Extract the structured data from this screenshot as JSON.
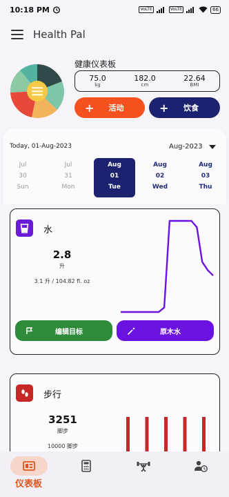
{
  "status_bar": {
    "time": "10:18 PM",
    "network_1": "VoLTE",
    "network_2": "VoLTE",
    "battery": "66"
  },
  "app_bar": {
    "title": "Health Pal",
    "menu_icon": "hamburger-icon"
  },
  "summary": {
    "title": "健康仪表板",
    "stats": [
      {
        "value": "75.0",
        "unit": "kg"
      },
      {
        "value": "182.0",
        "unit": "cm"
      },
      {
        "value": "22.64",
        "unit": "BMI"
      }
    ],
    "activity_button": {
      "icon": "+",
      "label": "活动",
      "color": "#f4511e"
    },
    "diet_button": {
      "icon": "+",
      "label": "饮食",
      "color": "#1c2270"
    }
  },
  "date_strip": {
    "today_label": "Today, 01-Aug-2023",
    "month_selector": "Aug-2023",
    "days": [
      {
        "month": "Jul",
        "date": "30",
        "weekday": "Sun",
        "state": "past"
      },
      {
        "month": "Jul",
        "date": "31",
        "weekday": "Mon",
        "state": "past"
      },
      {
        "month": "Aug",
        "date": "01",
        "weekday": "Tue",
        "state": "selected"
      },
      {
        "month": "Aug",
        "date": "02",
        "weekday": "Wed",
        "state": "future"
      },
      {
        "month": "Aug",
        "date": "03",
        "weekday": "Thu",
        "state": "future"
      }
    ]
  },
  "water_card": {
    "title": "水",
    "value": "2.8",
    "unit": "升",
    "detail": "3.1 升 / 104.82 fl. oz",
    "edit_goal_label": "编辑目标",
    "raw_water_label": "原木水",
    "line_color": "#6a12e0",
    "trend_levels": [
      0.0,
      0.0,
      0.0,
      0.0,
      0.0,
      0.0,
      0.0,
      0.0,
      0.05,
      1.0,
      1.0,
      1.0,
      1.0,
      1.0,
      0.93,
      0.55,
      0.46,
      0.4
    ]
  },
  "walk_card": {
    "title": "步行",
    "value": "3251",
    "unit": "脚步",
    "goal": "10000 脚步",
    "bar_color": "#c62828",
    "bar_count": 5
  },
  "bottom_nav": {
    "items": [
      {
        "name": "dashboard",
        "label": "仪表板",
        "active": true
      },
      {
        "name": "calculator",
        "label": "",
        "active": false
      },
      {
        "name": "fitness",
        "label": "",
        "active": false
      },
      {
        "name": "profile-history",
        "label": "",
        "active": false
      }
    ]
  }
}
